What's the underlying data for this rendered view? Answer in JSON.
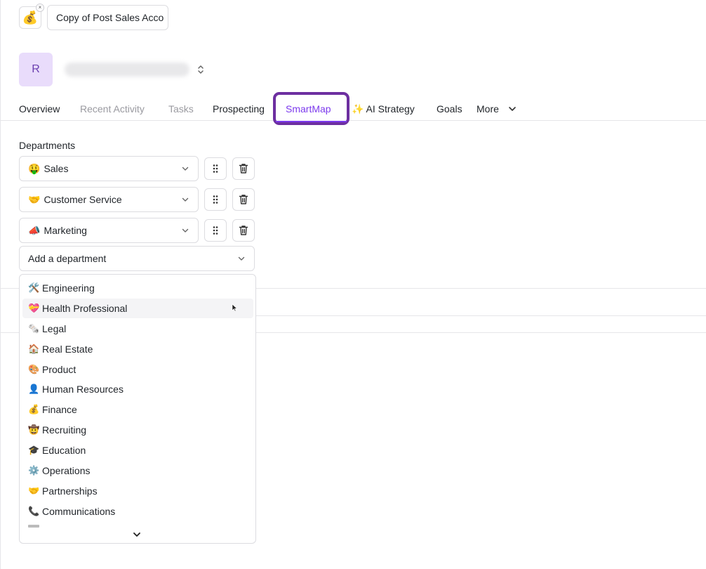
{
  "file": {
    "emoji": "💰",
    "close": "×",
    "title_value": "Copy of Post Sales Acco"
  },
  "account": {
    "avatar_initial": "R"
  },
  "tabs": {
    "overview": "Overview",
    "recent_activity": "Recent Activity",
    "tasks": "Tasks",
    "prospecting": "Prospecting",
    "smartmap": "SmartMap",
    "ai_strategy": "✨ AI Strategy",
    "goals": "Goals",
    "more": "More"
  },
  "departments": {
    "title": "Departments",
    "selected": [
      {
        "emoji": "🤑",
        "label": "Sales"
      },
      {
        "emoji": "🤝",
        "label": "Customer Service"
      },
      {
        "emoji": "📣",
        "label": "Marketing"
      }
    ],
    "add_placeholder": "Add a department",
    "options": [
      {
        "emoji": "🛠️",
        "label": "Engineering"
      },
      {
        "emoji": "💝",
        "label": "Health Professional"
      },
      {
        "emoji": "🗞️",
        "label": "Legal"
      },
      {
        "emoji": "🏠",
        "label": "Real Estate"
      },
      {
        "emoji": "🎨",
        "label": "Product"
      },
      {
        "emoji": "👤",
        "label": "Human Resources"
      },
      {
        "emoji": "💰",
        "label": "Finance"
      },
      {
        "emoji": "🤠",
        "label": "Recruiting"
      },
      {
        "emoji": "🎓",
        "label": "Education"
      },
      {
        "emoji": "⚙️",
        "label": "Operations"
      },
      {
        "emoji": "🤝",
        "label": "Partnerships"
      },
      {
        "emoji": "📞",
        "label": "Communications"
      }
    ]
  },
  "colors": {
    "accent": "#7c3aed",
    "highlight_border": "#6d2fa0",
    "avatar_bg": "#e9dcfb"
  }
}
